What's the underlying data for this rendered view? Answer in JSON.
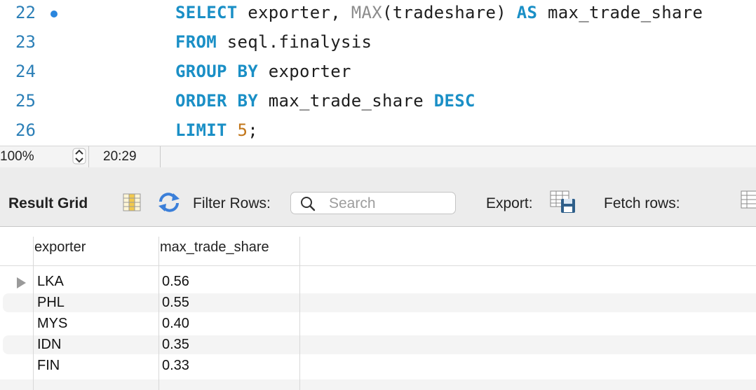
{
  "editor": {
    "lines": [
      {
        "num": "22",
        "parts": [
          {
            "t": "SELECT",
            "k": "kw"
          },
          {
            "t": " exporter, ",
            "k": ""
          },
          {
            "t": "MAX",
            "k": "fn"
          },
          {
            "t": "(tradeshare) ",
            "k": ""
          },
          {
            "t": "AS",
            "k": "kw"
          },
          {
            "t": " max_trade_share",
            "k": ""
          }
        ]
      },
      {
        "num": "23",
        "parts": [
          {
            "t": "FROM",
            "k": "kw"
          },
          {
            "t": " seql.finalysis",
            "k": ""
          }
        ]
      },
      {
        "num": "24",
        "parts": [
          {
            "t": "GROUP BY",
            "k": "kw"
          },
          {
            "t": " exporter",
            "k": ""
          }
        ]
      },
      {
        "num": "25",
        "parts": [
          {
            "t": "ORDER BY",
            "k": "kw"
          },
          {
            "t": " max_trade_share ",
            "k": ""
          },
          {
            "t": "DESC",
            "k": "kw"
          }
        ]
      },
      {
        "num": "26",
        "parts": [
          {
            "t": "LIMIT",
            "k": "kw"
          },
          {
            "t": " ",
            "k": ""
          },
          {
            "t": "5",
            "k": "num"
          },
          {
            "t": ";",
            "k": ""
          }
        ]
      }
    ]
  },
  "status": {
    "zoom": "100%",
    "cursor": "20:29"
  },
  "toolbar": {
    "result_grid_label": "Result Grid",
    "filter_rows_label": "Filter Rows:",
    "search_placeholder": "Search",
    "search_value": "",
    "export_label": "Export:",
    "fetch_rows_label": "Fetch rows:"
  },
  "grid": {
    "columns": [
      "exporter",
      "max_trade_share"
    ],
    "rows": [
      [
        "LKA",
        "0.56"
      ],
      [
        "PHL",
        "0.55"
      ],
      [
        "MYS",
        "0.40"
      ],
      [
        "IDN",
        "0.35"
      ],
      [
        "FIN",
        "0.33"
      ]
    ]
  },
  "colors": {
    "keyword": "#1a8fc6",
    "line_number": "#2b7fb7",
    "number": "#c2761a",
    "breakpoint": "#2a86de"
  }
}
